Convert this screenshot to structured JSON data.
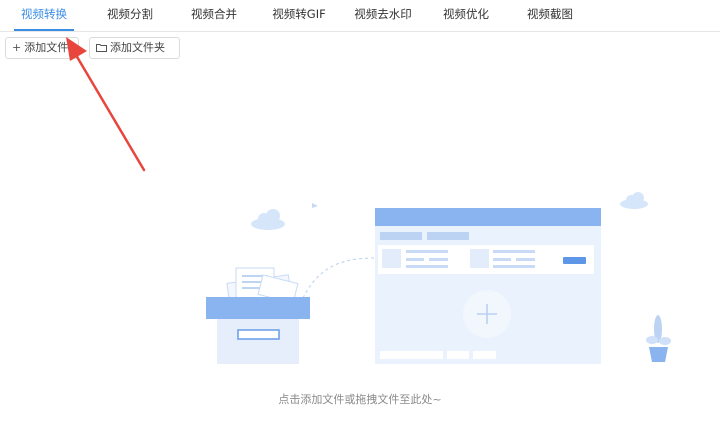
{
  "tabs": [
    {
      "label": "视频转换",
      "active": true
    },
    {
      "label": "视频分割",
      "active": false
    },
    {
      "label": "视频合并",
      "active": false
    },
    {
      "label": "视频转GIF",
      "active": false
    },
    {
      "label": "视频去水印",
      "active": false
    },
    {
      "label": "视频优化",
      "active": false
    },
    {
      "label": "视频截图",
      "active": false
    }
  ],
  "toolbar": {
    "add_file_label": "添加文件",
    "add_folder_label": "添加文件夹",
    "add_file_icon": "plus-icon",
    "add_folder_icon": "folder-icon"
  },
  "drop_zone": {
    "hint": "点击添加文件或拖拽文件至此处~"
  },
  "colors": {
    "accent": "#3a8ee6",
    "annotation_arrow": "#e8453c",
    "illustration_blue": "#8ab4f0",
    "illustration_light": "#e9f1fd"
  }
}
